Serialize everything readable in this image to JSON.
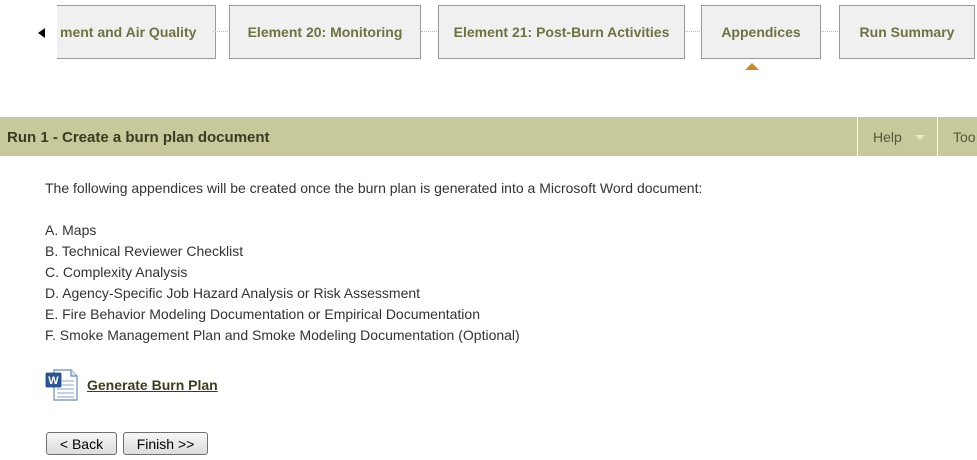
{
  "steps": {
    "items": [
      {
        "label": "ment and Air Quality"
      },
      {
        "label": "Element 20: Monitoring"
      },
      {
        "label": "Element 21: Post-Burn Activities"
      },
      {
        "label": "Appendices",
        "active": true
      },
      {
        "label": "Run Summary"
      }
    ]
  },
  "titlebar": {
    "title": "Run 1 - Create a burn plan document",
    "help_label": "Help",
    "tools_label": "Too"
  },
  "content": {
    "intro": "The following appendices will be created once the burn plan is generated into a Microsoft Word document:",
    "appendices": [
      "A. Maps",
      "B. Technical Reviewer Checklist",
      "C. Complexity Analysis",
      "D. Agency-Specific Job Hazard Analysis or Risk Assessment",
      "E. Fire Behavior Modeling Documentation or Empirical Documentation",
      "F. Smoke Management Plan and Smoke Modeling Documentation (Optional)"
    ],
    "generate_link": "Generate Burn Plan",
    "generate_icon": "word-document-icon"
  },
  "buttons": {
    "back": "< Back",
    "finish": "Finish >>"
  },
  "colors": {
    "titlebar_bg": "#c7c99a",
    "step_text": "#6e7240",
    "active_marker": "#c98a2a"
  }
}
